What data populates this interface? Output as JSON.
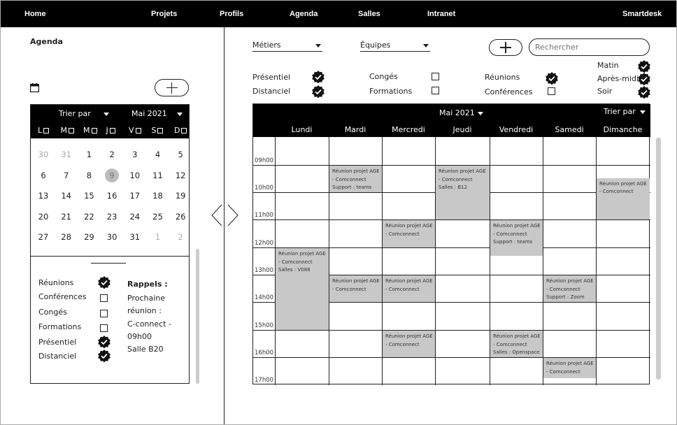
{
  "nav": {
    "home": "Home",
    "projets": "Projets",
    "profils": "Profils",
    "agenda": "Agenda",
    "salles": "Salles",
    "intranet": "Intranet",
    "smartdesk": "Smartdesk"
  },
  "sidebar": {
    "title": "Agenda",
    "sort_label": "Trier par",
    "month_label": "Mai 2021",
    "weekday_letters": [
      "L",
      "M",
      "M",
      "J",
      "V",
      "S",
      "D"
    ],
    "weeks": [
      [
        "30",
        "31",
        "1",
        "2",
        "3",
        "4",
        "5"
      ],
      [
        "6",
        "7",
        "8",
        "9",
        "10",
        "11",
        "12"
      ],
      [
        "13",
        "14",
        "15",
        "16",
        "17",
        "18",
        "19"
      ],
      [
        "20",
        "21",
        "22",
        "23",
        "24",
        "25",
        "26"
      ],
      [
        "27",
        "28",
        "29",
        "30",
        "31",
        "1",
        "2"
      ]
    ],
    "filters": [
      {
        "label": "Réunions",
        "checked": true
      },
      {
        "label": "Conférences",
        "checked": false
      },
      {
        "label": "Congés",
        "checked": false
      },
      {
        "label": "Formations",
        "checked": false
      },
      {
        "label": "Présentiel",
        "checked": true
      },
      {
        "label": "Distanciel",
        "checked": true
      }
    ],
    "rappels_title": "Rappels :",
    "rappels_lines": [
      "Prochaine",
      "réunion :",
      "C-connect -",
      "09h00",
      "Salle B20"
    ]
  },
  "toolbar": {
    "metiers": "Métiers",
    "equipes": "Équipes",
    "search_placeholder": "Rechercher"
  },
  "filters": {
    "presentiel": "Présentiel",
    "distanciel": "Distanciel",
    "conges": "Congés",
    "formations": "Formations",
    "reunions": "Réunions",
    "conferences": "Conférences",
    "matin": "Matin",
    "apres_midi": "Après-midi",
    "soir": "Soir"
  },
  "calendar": {
    "month_label": "Mai 2021",
    "sort_label": "Trier par",
    "days": [
      "Lundi",
      "Mardi",
      "Mercredi",
      "Jeudi",
      "Vendredi",
      "Samedi",
      "Dimanche"
    ],
    "hours": [
      "09h00",
      "10h00",
      "11h00",
      "12h00",
      "13h00",
      "14h00",
      "15h00",
      "16h00",
      "17h00"
    ],
    "events": [
      {
        "lines": [
          "Réunion projet AGE",
          "- Comconnect",
          "Support : teams"
        ]
      },
      {
        "lines": [
          "Réunion projet AGE",
          "- Comconnect",
          "Salles : B12"
        ]
      },
      {
        "lines": [
          "Réunion projet AGE",
          "- Comconnect"
        ]
      },
      {
        "lines": [
          "Réunion projet AGE",
          "- Comconnect"
        ]
      },
      {
        "lines": [
          "Réunion projet AGE",
          "- Comconnect",
          "Support : teams"
        ]
      },
      {
        "lines": [
          "Réunion projet AGE",
          "- Comconnect",
          "Salles : V088"
        ]
      },
      {
        "lines": [
          "Réunion projet AGE",
          "- Comconnect"
        ]
      },
      {
        "lines": [
          "Réunion projet AGE",
          "- Comconnect"
        ]
      },
      {
        "lines": [
          "Réunion projet AGE",
          "- Comconnect",
          "Support : Zoom"
        ]
      },
      {
        "lines": [
          "Réunion projet AGE",
          "- Comconnect"
        ]
      },
      {
        "lines": [
          "Réunion projet AGE",
          "- Comconnect",
          "Salles : Openspace"
        ]
      },
      {
        "lines": [
          "Réunion projet AGE",
          "- Comconnect"
        ]
      }
    ]
  },
  "colors": {
    "event_fill": "#c8c8c8",
    "bar": "#000000",
    "selected_day": "#bdbdbd"
  }
}
